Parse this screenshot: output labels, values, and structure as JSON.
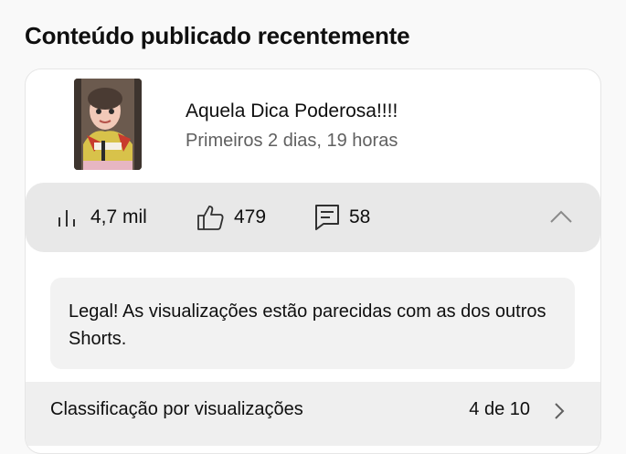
{
  "section": {
    "title": "Conteúdo publicado recentemente"
  },
  "video": {
    "title": "Aquela Dica Poderosa!!!!",
    "subtitle": "Primeiros 2 dias, 19 horas",
    "thumbnail_icon": "video-thumbnail"
  },
  "metrics": {
    "views": {
      "icon": "bar-chart-icon",
      "value": "4,7 mil"
    },
    "likes": {
      "icon": "thumbs-up-icon",
      "value": "479"
    },
    "comments": {
      "icon": "comment-icon",
      "value": "58"
    },
    "collapse_icon": "chevron-up-icon"
  },
  "insight": {
    "text": "Legal! As visualizações estão parecidas com as dos outros Shorts."
  },
  "ranking": {
    "label": "Classificação por visualizações",
    "value": "4 de 10",
    "icon": "chevron-right-icon"
  }
}
